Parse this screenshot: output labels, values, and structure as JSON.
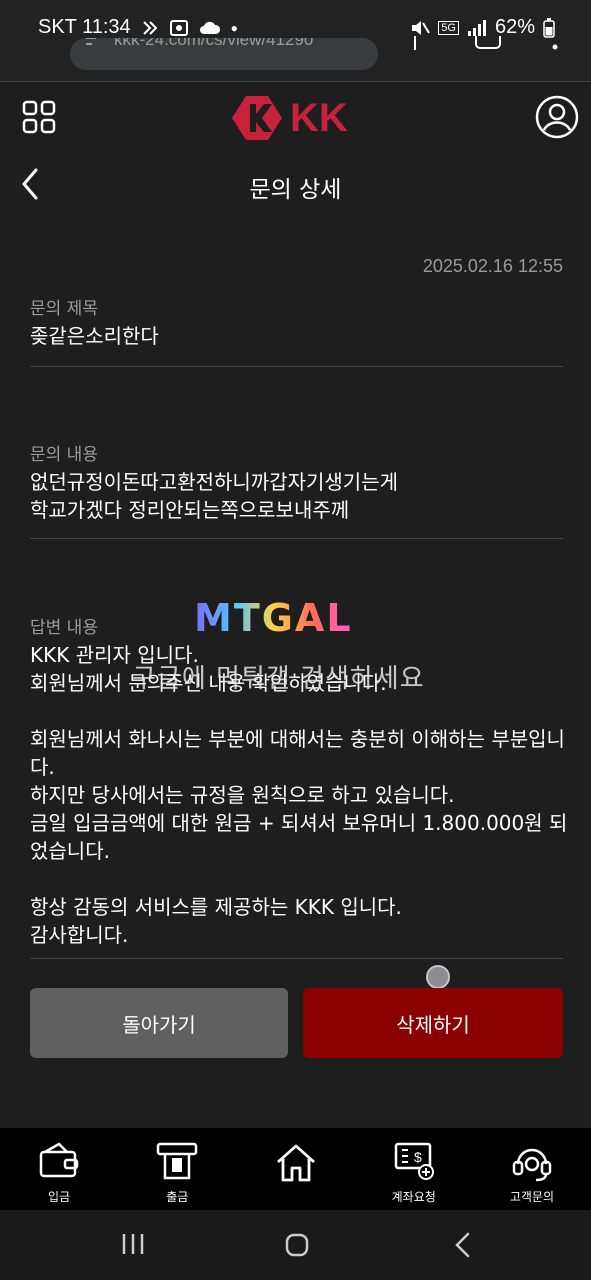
{
  "status": {
    "carrier_time": "SKT 11:34",
    "network": "5G",
    "battery": "62%"
  },
  "browser": {
    "url": "kkk-24.com/cs/view/41290"
  },
  "header": {
    "brand": "KK"
  },
  "page": {
    "title": "문의 상세",
    "date": "2025.02.16 12:55",
    "subject_label": "문의 제목",
    "subject": "좆같은소리한다",
    "content_label": "문의 내용",
    "content_line1": "없던규정이돈따고환전하니까갑자기생기는게",
    "content_line2": "학교가겠다 정리안되는쪽으로보내주께",
    "answer_label": "답변 내용",
    "answer": "KKK 관리자 입니다.\n회원님께서 문의주신 내용 확인하였습니다.\n\n회원님께서 화나시는 부분에 대해서는 충분히 이해하는 부분입니다.\n하지만 당사에서는 규정을 원칙으로 하고 있습니다.\n금일 입금금액에 대한 원금 + 되셔서 보유머니 1.800.000원 되었습니다.\n\n항상 감동의 서비스를 제공하는 KKK 입니다.\n감사합니다."
  },
  "watermark": {
    "logo": "MTGAL",
    "text": "구글에 먹튀갤 검색하세요"
  },
  "buttons": {
    "back": "돌아가기",
    "delete": "삭제하기"
  },
  "bottom_nav": [
    {
      "label": "입금",
      "icon": "wallet-icon"
    },
    {
      "label": "출금",
      "icon": "atm-icon"
    },
    {
      "label": "",
      "icon": "home-icon"
    },
    {
      "label": "계좌요청",
      "icon": "account-request-icon"
    },
    {
      "label": "고객문의",
      "icon": "headset-icon"
    }
  ],
  "colors": {
    "accent": "#8b0000",
    "background": "#1e1e1f",
    "logo": "#c8213c"
  }
}
